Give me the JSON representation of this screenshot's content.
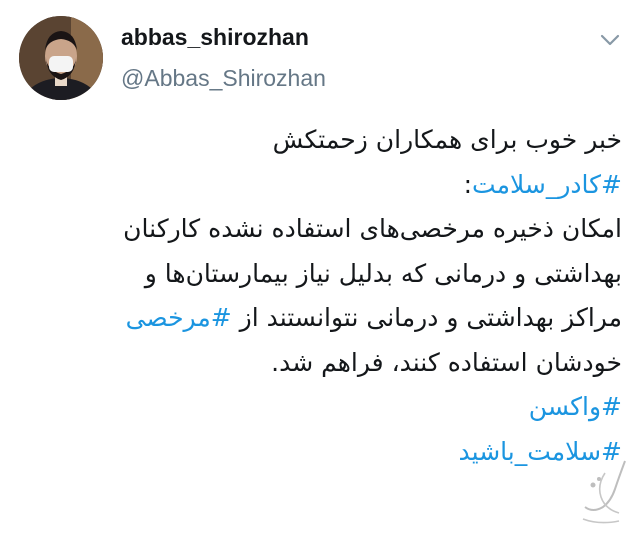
{
  "author": {
    "display_name": "abbas_shirozhan",
    "handle": "@Abbas_Shirozhan"
  },
  "icons": {
    "menu": "chevron-down-icon",
    "watermark": "watermark-logo"
  },
  "colors": {
    "hashtag": "#1b95e0",
    "text": "#14171a",
    "secondary_text": "#657786"
  },
  "tweet": {
    "line1": "خبر خوب برای همکاران زحمتکش",
    "hashtag_staff": "#کادر_سلامت",
    "colon": ":",
    "line3": "امکان ذخیره مرخصی‌های استفاده نشده کارکنان",
    "line4": "بهداشتی و درمانی که بدلیل نیاز بیمارستان‌ها و",
    "line5_text": "مراکز بهداشتی و درمانی نتوانستند از ",
    "hashtag_leave": "#مرخصی",
    "line6": "خودشان استفاده کنند، فراهم شد.",
    "hashtag_vaccine": "#واکسن",
    "hashtag_healthy": "#سلامت_باشید"
  }
}
